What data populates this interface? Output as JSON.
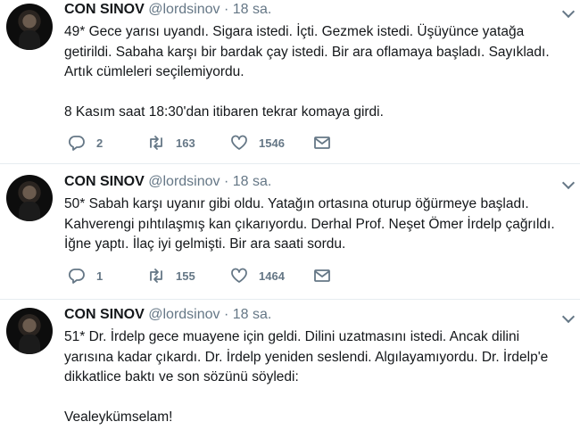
{
  "tweets": [
    {
      "name": "CON SINOV",
      "handle": "@lordsinov",
      "dot": "·",
      "time": "18 sa.",
      "text": "49* Gece yarısı uyandı. Sigara istedi. İçti. Gezmek istedi. Üşüyünce yatağa getirildi. Sabaha karşı bir bardak çay istedi. Bir ara oflamaya başladı. Sayıkladı. Artık cümleleri seçilemiyordu.\n\n8 Kasım saat 18:30'dan itibaren tekrar komaya girdi.",
      "replies": "2",
      "retweets": "163",
      "likes": "1546"
    },
    {
      "name": "CON SINOV",
      "handle": "@lordsinov",
      "dot": "·",
      "time": "18 sa.",
      "text": "50* Sabah karşı uyanır gibi oldu. Yatağın ortasına oturup öğürmeye başladı. Kahverengi pıhtılaşmış kan çıkarıyordu. Derhal Prof. Neşet Ömer İrdelp çağrıldı. İğne yaptı. İlaç iyi gelmişti. Bir ara saati sordu.",
      "replies": "1",
      "retweets": "155",
      "likes": "1464"
    },
    {
      "name": "CON SINOV",
      "handle": "@lordsinov",
      "dot": "·",
      "time": "18 sa.",
      "text": "51* Dr. İrdelp gece muayene için geldi. Dilini uzatmasını istedi. Ancak dilini yarısına kadar çıkardı. Dr. İrdelp yeniden seslendi. Algılayamıyordu. Dr. İrdelp'e dikkatlice baktı ve son sözünü söyledi:\n\nVealeykümselam!"
    }
  ],
  "icons": {
    "avatar": "profile-photo",
    "menu": "chevron-down-icon",
    "reply": "reply-icon",
    "retweet": "retweet-icon",
    "like": "heart-icon",
    "dm": "envelope-icon"
  },
  "colors": {
    "secondary": "#657786",
    "text": "#14171a",
    "divider": "#e6ecf0"
  }
}
